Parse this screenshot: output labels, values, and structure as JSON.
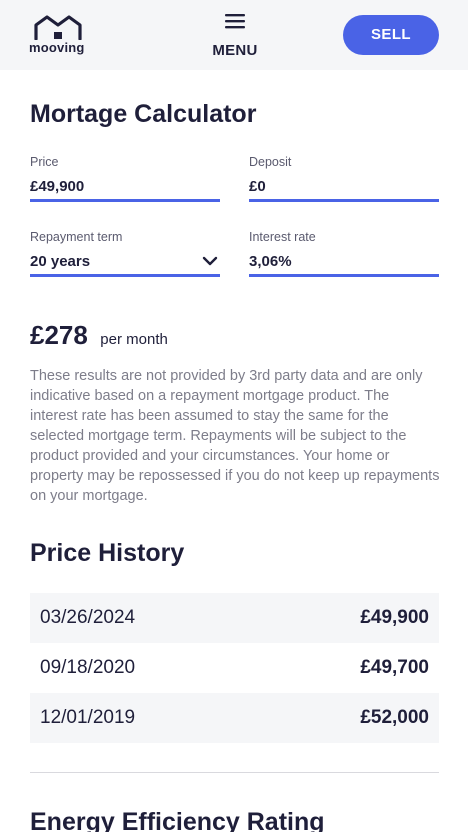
{
  "header": {
    "logo_text": "mooving",
    "menu_label": "MENU",
    "sell_label": "SELL",
    "accent_color": "#4a63e6"
  },
  "mortgage": {
    "title": "Mortage Calculator",
    "price": {
      "label": "Price",
      "value": "£49,900"
    },
    "deposit": {
      "label": "Deposit",
      "value": "£0"
    },
    "term": {
      "label": "Repayment term",
      "value": "20 years"
    },
    "rate": {
      "label": "Interest rate",
      "value": "3,06%"
    },
    "monthly_amount": "£278",
    "monthly_unit": "per month",
    "disclaimer": "These results are not provided by 3rd party data and are only indicative based on a repayment mortgage product. The interest rate has been assumed to stay the same for the selected mortgage term. Repayments will be subject to the product provided and your circumstances. Your home or property may be repossessed if you do not keep up repayments on your mortgage."
  },
  "price_history": {
    "title": "Price History",
    "rows": [
      {
        "date": "03/26/2024",
        "price": "£49,900"
      },
      {
        "date": "09/18/2020",
        "price": "£49,700"
      },
      {
        "date": "12/01/2019",
        "price": "£52,000"
      }
    ]
  },
  "energy": {
    "title": "Energy Efficiency Rating"
  }
}
